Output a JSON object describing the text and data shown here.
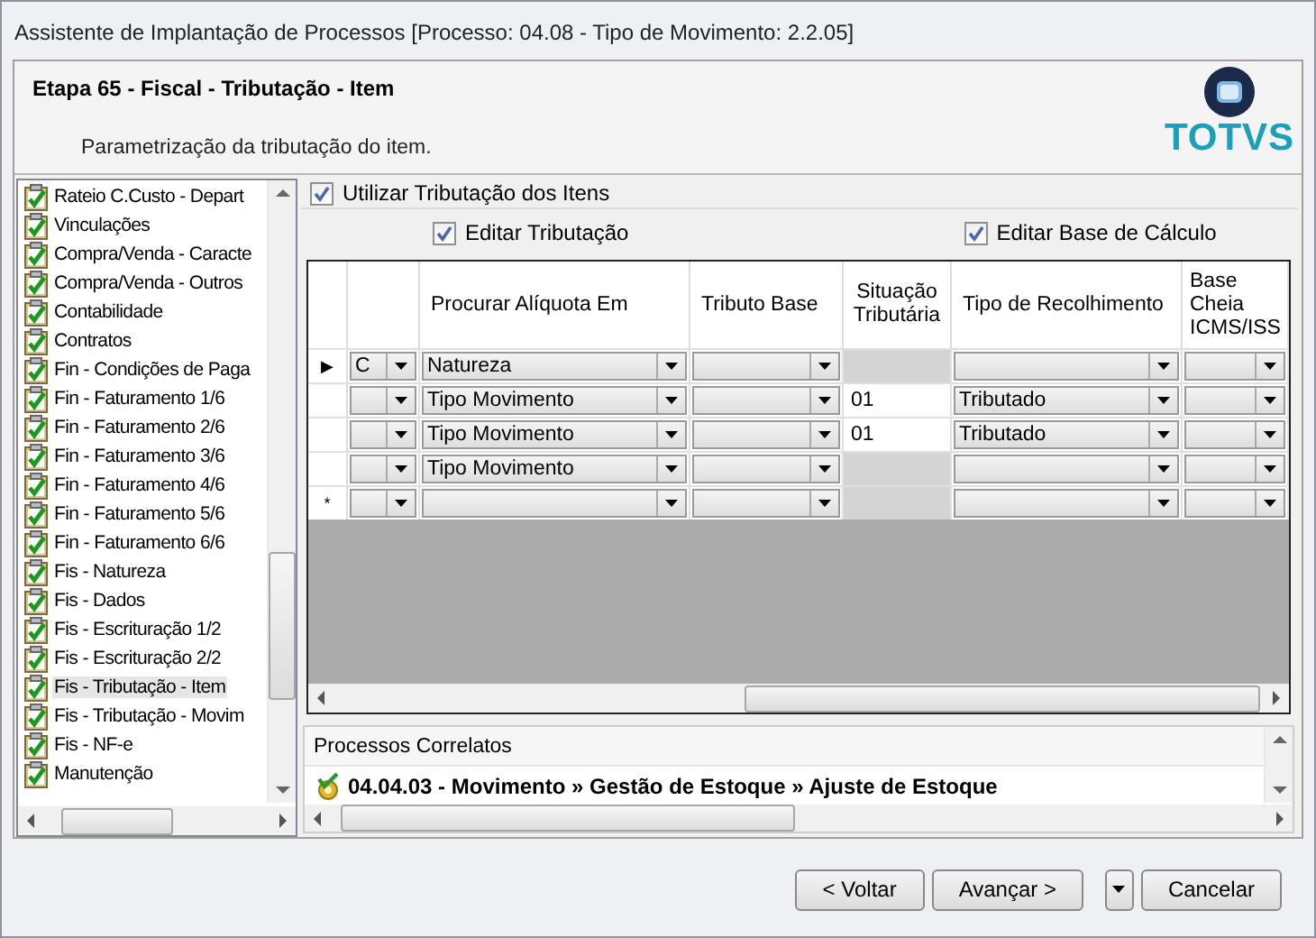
{
  "window": {
    "title": "Assistente de Implantação de Processos [Processo: 04.08 - Tipo de Movimento: 2.2.05]"
  },
  "header": {
    "title": "Etapa 65 - Fiscal - Tributação - Item",
    "subtitle": "Parametrização da tributação do item.",
    "logo_text": "TOTVS"
  },
  "steps": [
    {
      "label": "Rateio C.Custo - Depart",
      "checked": true,
      "selected": false
    },
    {
      "label": "Vinculações",
      "checked": true,
      "selected": false
    },
    {
      "label": "Compra/Venda - Caracte",
      "checked": true,
      "selected": false
    },
    {
      "label": "Compra/Venda - Outros",
      "checked": true,
      "selected": false
    },
    {
      "label": "Contabilidade",
      "checked": true,
      "selected": false
    },
    {
      "label": "Contratos",
      "checked": true,
      "selected": false
    },
    {
      "label": "Fin - Condições de Paga",
      "checked": true,
      "selected": false
    },
    {
      "label": "Fin - Faturamento 1/6",
      "checked": true,
      "selected": false
    },
    {
      "label": "Fin - Faturamento 2/6",
      "checked": true,
      "selected": false
    },
    {
      "label": "Fin - Faturamento 3/6",
      "checked": true,
      "selected": false
    },
    {
      "label": "Fin - Faturamento 4/6",
      "checked": true,
      "selected": false
    },
    {
      "label": "Fin - Faturamento 5/6",
      "checked": true,
      "selected": false
    },
    {
      "label": "Fin - Faturamento 6/6",
      "checked": true,
      "selected": false
    },
    {
      "label": "Fis - Natureza",
      "checked": true,
      "selected": false
    },
    {
      "label": "Fis - Dados",
      "checked": true,
      "selected": false
    },
    {
      "label": "Fis - Escrituração 1/2",
      "checked": true,
      "selected": false
    },
    {
      "label": "Fis - Escrituração 2/2",
      "checked": true,
      "selected": false
    },
    {
      "label": "Fis - Tributação - Item",
      "checked": true,
      "selected": true
    },
    {
      "label": "Fis - Tributação - Movim",
      "checked": true,
      "selected": false
    },
    {
      "label": "Fis - NF-e",
      "checked": true,
      "selected": false
    },
    {
      "label": "Manutenção",
      "checked": true,
      "selected": false
    }
  ],
  "options": [
    {
      "label": "Utilizar Tributação dos Itens",
      "checked": true
    },
    {
      "label": "Editar Tributação",
      "checked": true
    },
    {
      "label": "Editar Base de Cálculo",
      "checked": true
    }
  ],
  "table": {
    "columns": [
      "",
      "Procurar Alíquota Em",
      "Tributo Base",
      "Situação Tributária",
      "Tipo de Recolhimento",
      "Base Cheia ICMS/ISS"
    ],
    "rows": [
      {
        "marker": "▶",
        "cells": [
          {
            "kind": "combo",
            "value": "C"
          },
          {
            "kind": "combo",
            "value": "Natureza"
          },
          {
            "kind": "combo"
          },
          {
            "kind": "text",
            "disabled": true
          },
          {
            "kind": "combo"
          },
          {
            "kind": "combo"
          }
        ]
      },
      {
        "cells": [
          {
            "kind": "combo"
          },
          {
            "kind": "combo",
            "value": "Tipo Movimento"
          },
          {
            "kind": "combo"
          },
          {
            "kind": "text",
            "disabled": false,
            "value": "01"
          },
          {
            "kind": "combo",
            "value": "Tributado"
          },
          {
            "kind": "combo"
          }
        ]
      },
      {
        "cells": [
          {
            "kind": "combo"
          },
          {
            "kind": "combo",
            "value": "Tipo Movimento"
          },
          {
            "kind": "combo"
          },
          {
            "kind": "text",
            "disabled": false,
            "value": "01"
          },
          {
            "kind": "combo",
            "value": "Tributado"
          },
          {
            "kind": "combo"
          }
        ]
      },
      {
        "cells": [
          {
            "kind": "combo"
          },
          {
            "kind": "combo",
            "value": "Tipo Movimento"
          },
          {
            "kind": "combo"
          },
          {
            "kind": "text",
            "disabled": true
          },
          {
            "kind": "combo"
          },
          {
            "kind": "combo"
          }
        ]
      },
      {
        "marker": "*",
        "cells": [
          {
            "kind": "combo"
          },
          {
            "kind": "combo"
          },
          {
            "kind": "combo"
          },
          {
            "kind": "text",
            "disabled": true
          },
          {
            "kind": "combo"
          },
          {
            "kind": "combo"
          }
        ]
      }
    ]
  },
  "related": {
    "title": "Processos Correlatos",
    "items": [
      "04.04.03 - Movimento » Gestão de Estoque » Ajuste de Estoque"
    ]
  },
  "buttons": [
    {
      "kind": "push",
      "label": "< Voltar"
    },
    {
      "kind": "push",
      "label": "Avançar >"
    },
    {
      "kind": "menu"
    },
    {
      "kind": "push",
      "label": "Cancelar"
    }
  ]
}
